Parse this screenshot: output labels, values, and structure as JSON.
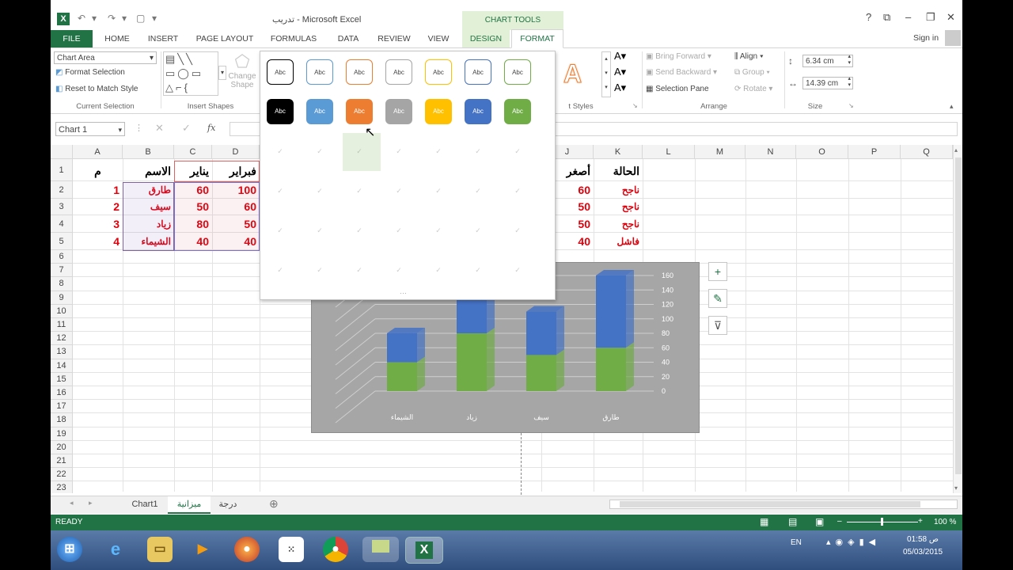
{
  "window": {
    "title": "تدريب - Microsoft Excel",
    "chart_tools": "CHART TOOLS",
    "sign_in": "Sign in",
    "controls": [
      "?",
      "⧉",
      "–",
      "❐",
      "✕"
    ]
  },
  "tabs": [
    {
      "label": "FILE"
    },
    {
      "label": "HOME"
    },
    {
      "label": "INSERT"
    },
    {
      "label": "PAGE LAYOUT"
    },
    {
      "label": "FORMULAS"
    },
    {
      "label": "DATA"
    },
    {
      "label": "REVIEW"
    },
    {
      "label": "VIEW"
    },
    {
      "label": "DESIGN"
    },
    {
      "label": "FORMAT"
    }
  ],
  "ribbon": {
    "chart_element": "Chart Area",
    "format_selection": "Format Selection",
    "reset_style": "Reset to Match Style",
    "group_current": "Current Selection",
    "group_insert_shapes": "Insert Shapes",
    "change_shape": "Change Shape",
    "group_wordart": "t Styles",
    "bring_forward": "Bring Forward",
    "send_backward": "Send Backward",
    "selection_pane": "Selection Pane",
    "align": "Align",
    "group": "Group",
    "rotate": "Rotate",
    "group_arrange": "Arrange",
    "height": "6.34 cm",
    "width": "14.39 cm",
    "group_size": "Size"
  },
  "formula_bar": {
    "name_box": "Chart 1",
    "fx": "fx"
  },
  "gallery": {
    "swatch_label": "Abc",
    "outline_colors": [
      "#000000",
      "#5b9bd5",
      "#ed7d31",
      "#a5a5a5",
      "#ffc000",
      "#4472c4",
      "#70ad47"
    ],
    "fill_colors": [
      "#000000",
      "#5b9bd5",
      "#ed7d31",
      "#a5a5a5",
      "#ffc000",
      "#4472c4",
      "#70ad47"
    ]
  },
  "columns": [
    "A",
    "B",
    "C",
    "D",
    "J",
    "K",
    "L",
    "M",
    "N",
    "O",
    "P",
    "Q"
  ],
  "rows": [
    "1",
    "2",
    "3",
    "4",
    "5",
    "6",
    "7",
    "8",
    "9",
    "10",
    "11",
    "12",
    "13",
    "14",
    "15",
    "16",
    "17",
    "18",
    "19",
    "20",
    "21",
    "22",
    "23"
  ],
  "sheet": {
    "headers": {
      "a": "م",
      "b": "الاسم",
      "c": "يناير",
      "d": "فبراير",
      "j": "أصغر",
      "k": "الحالة"
    },
    "data": [
      {
        "a": "1",
        "b": "طارق",
        "c": "60",
        "d": "100",
        "j": "60",
        "k": "ناجح"
      },
      {
        "a": "2",
        "b": "سيف",
        "c": "50",
        "d": "60",
        "j": "50",
        "k": "ناجح"
      },
      {
        "a": "3",
        "b": "زياد",
        "c": "80",
        "d": "50",
        "j": "50",
        "k": "ناجح"
      },
      {
        "a": "4",
        "b": "الشيماء",
        "c": "40",
        "d": "40",
        "j": "40",
        "k": "فاشل"
      }
    ]
  },
  "chart_data": {
    "type": "bar",
    "stacked": true,
    "three_d": true,
    "categories": [
      "الشيماء",
      "زياد",
      "سيف",
      "طارق"
    ],
    "series": [
      {
        "values": [
          40,
          80,
          50,
          60
        ],
        "color": "#70ad47"
      },
      {
        "values": [
          40,
          50,
          60,
          100
        ],
        "color": "#4472c4"
      }
    ],
    "yticks": [
      "0",
      "20",
      "40",
      "60",
      "80",
      "100",
      "120",
      "140",
      "160"
    ],
    "ylim": [
      0,
      160
    ],
    "y_axis_side": "right",
    "background": "#a6a6a6"
  },
  "chart_buttons": [
    "+",
    "✎",
    "⊽"
  ],
  "sheet_tabs": [
    {
      "label": "Chart1"
    },
    {
      "label": "ميزانية"
    },
    {
      "label": "درجة"
    }
  ],
  "status": {
    "ready": "READY",
    "zoom": "100 %"
  },
  "taskbar": {
    "lang": "EN",
    "time": "01:58 ص",
    "date": "05/03/2015"
  }
}
